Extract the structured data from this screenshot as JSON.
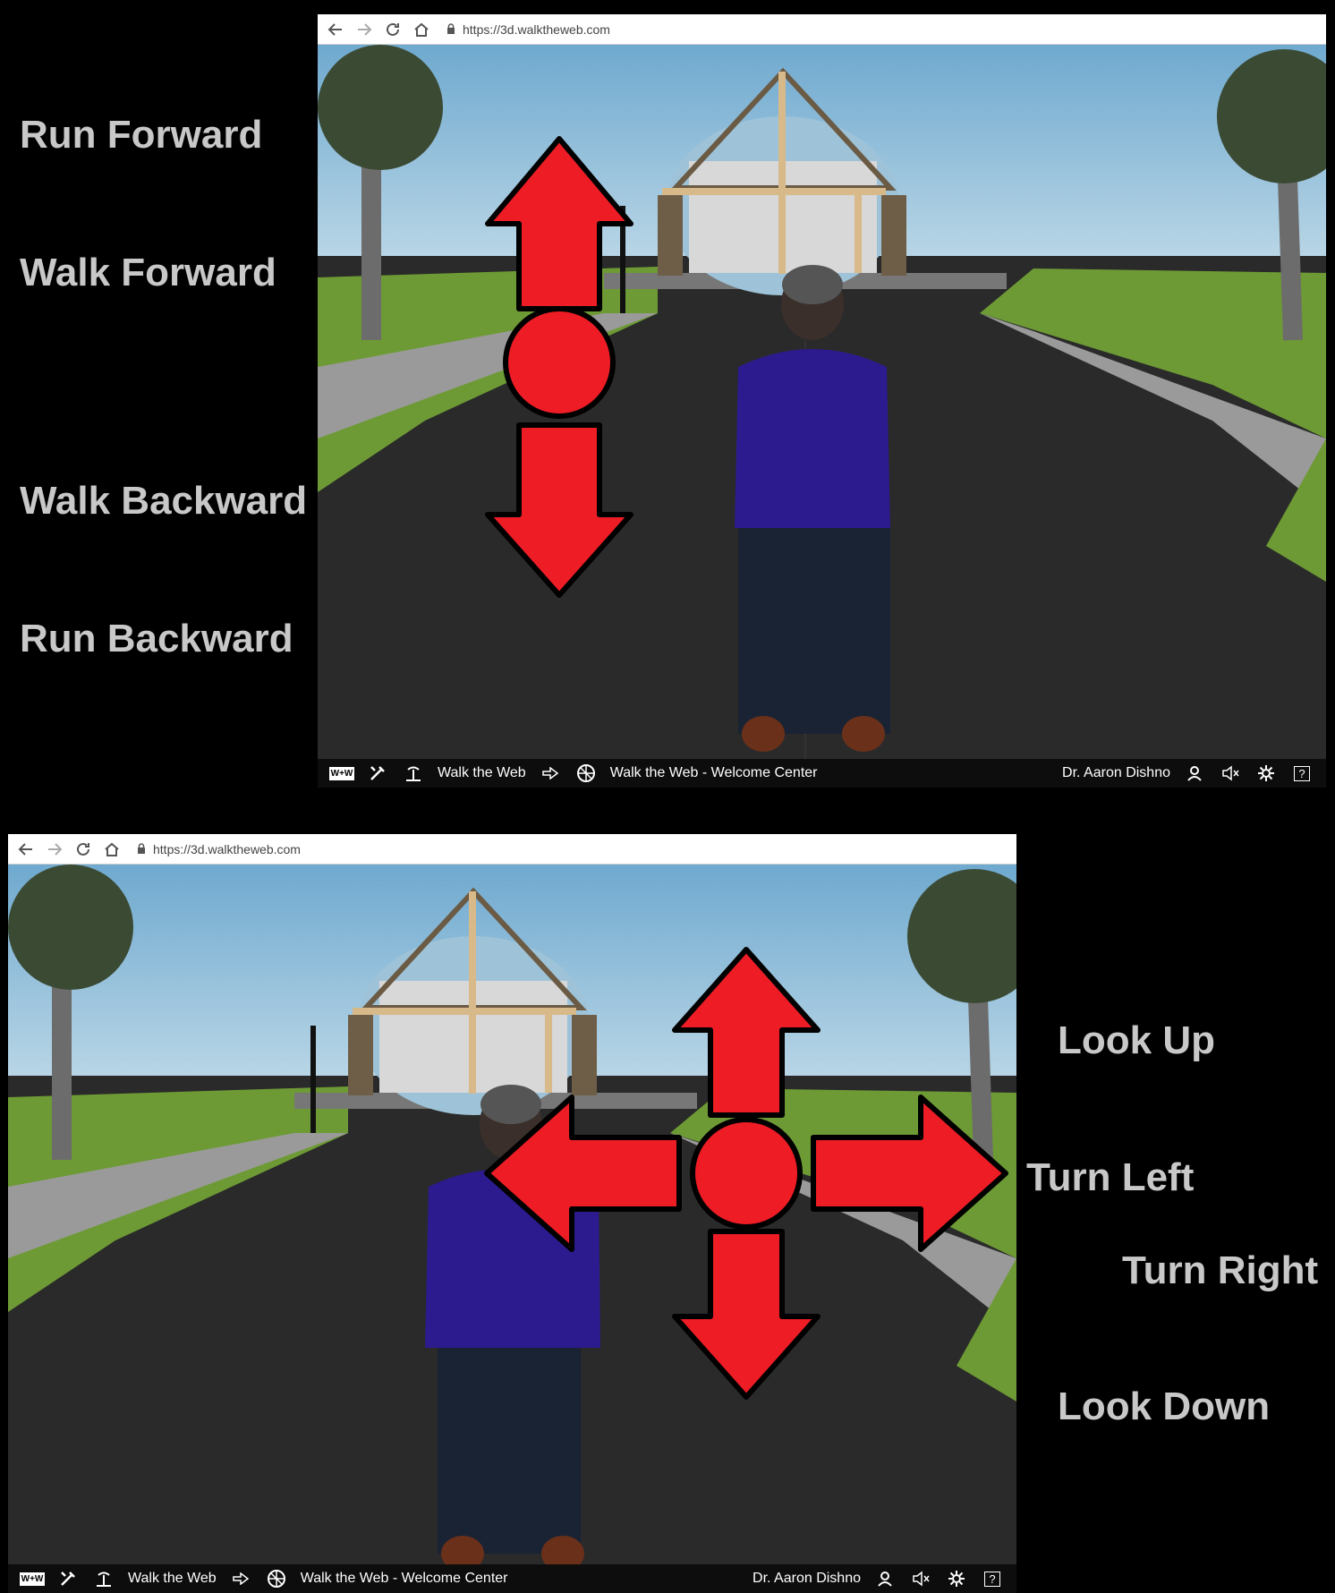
{
  "labels_top": {
    "run_forward": "Run Forward",
    "walk_forward": "Walk Forward",
    "walk_backward": "Walk Backward",
    "run_backward": "Run Backward"
  },
  "labels_bottom": {
    "look_up": "Look Up",
    "turn_left": "Turn Left",
    "turn_right": "Turn Right",
    "look_down": "Look Down"
  },
  "browser": {
    "url": "https://3d.walktheweb.com"
  },
  "taskbar": {
    "logo_text": "W+W",
    "community": "Walk the Web",
    "building": "Walk the Web - Welcome Center",
    "user": "Dr. Aaron Dishno",
    "help": "?"
  },
  "icons": [
    "back-arrow-icon",
    "forward-arrow-icon",
    "reload-icon",
    "home-icon",
    "lock-icon",
    "wrench-icon",
    "island-icon",
    "arrow-right-icon",
    "globe-building-icon",
    "user-icon",
    "mute-icon",
    "settings-icon",
    "help-icon"
  ],
  "colors": {
    "arrow_fill": "#ee1c25",
    "label_text": "#c8c8c8",
    "sky": "#7fb6d8",
    "grass": "#6d9a34",
    "road": "#2a2a2a",
    "shirt": "#2b1b8f"
  }
}
